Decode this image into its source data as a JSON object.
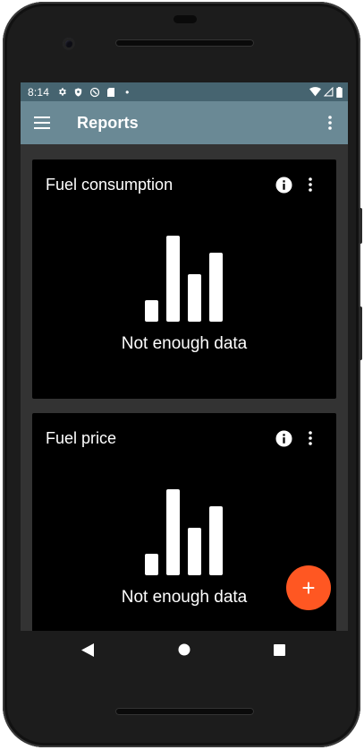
{
  "status_bar": {
    "time": "8:14",
    "icons_left": [
      "settings-icon",
      "shield-icon",
      "vpn-icon",
      "sd-card-icon",
      "notification-dot-icon"
    ],
    "icons_right": [
      "wifi-icon",
      "signal-icon",
      "battery-icon"
    ],
    "dot": "•"
  },
  "app_bar": {
    "title": "Reports",
    "menu_icon": "hamburger-menu-icon",
    "overflow_icon": "more-vertical-icon"
  },
  "cards": [
    {
      "title": "Fuel consumption",
      "empty_message": "Not enough data",
      "info_icon": "info-icon",
      "menu_icon": "more-vertical-icon",
      "empty_icon": "bar-chart-icon"
    },
    {
      "title": "Fuel price",
      "empty_message": "Not enough data",
      "info_icon": "info-icon",
      "menu_icon": "more-vertical-icon",
      "empty_icon": "bar-chart-icon"
    }
  ],
  "fab": {
    "label": "+",
    "icon": "add-icon"
  },
  "nav_bar": {
    "buttons": [
      "back-icon",
      "home-icon",
      "recents-icon"
    ]
  },
  "colors": {
    "status_bar": "#466470",
    "app_bar": "#6a8995",
    "background": "#333333",
    "card": "#000000",
    "fab": "#ff5722",
    "text": "#ffffff"
  }
}
